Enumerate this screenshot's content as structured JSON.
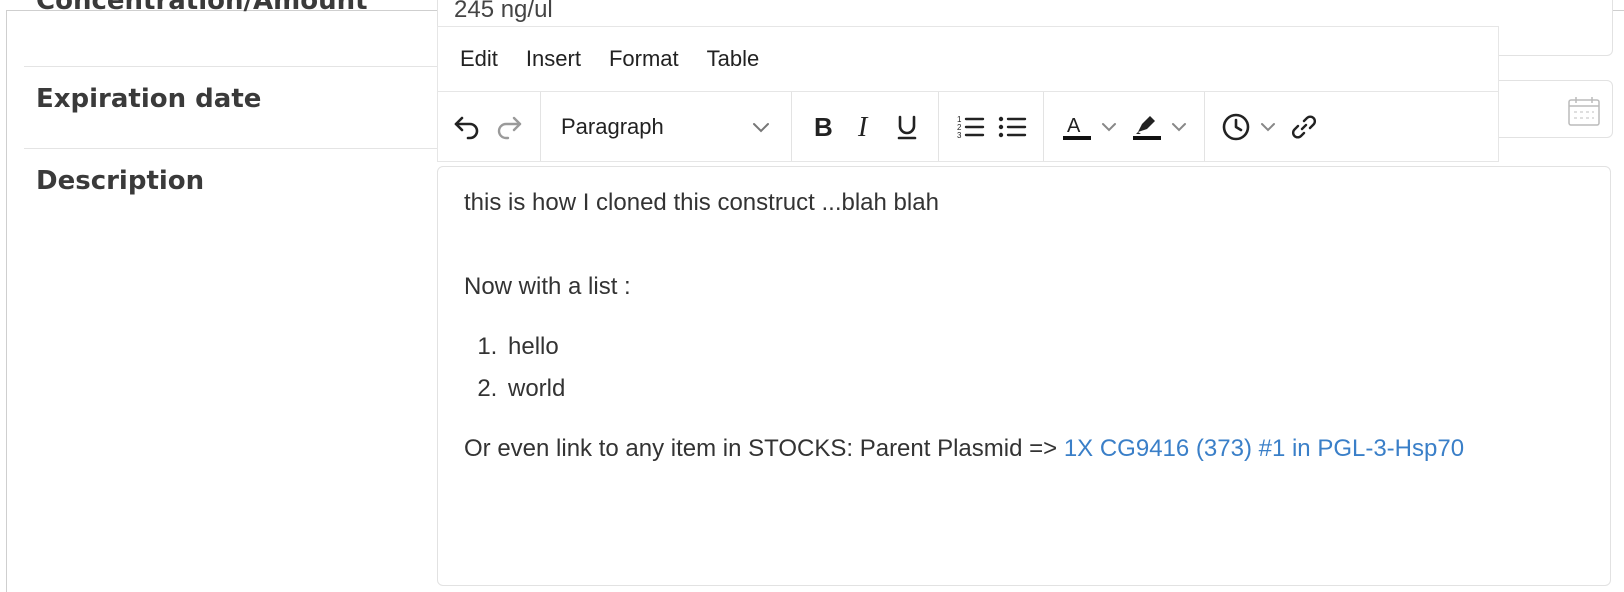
{
  "form": {
    "concentration_label": "Concentration/Amount",
    "concentration_value": "245 ng/ul",
    "expiration_label": "Expiration date",
    "description_label": "Description"
  },
  "editor": {
    "menu": [
      "Edit",
      "Insert",
      "Format",
      "Table"
    ],
    "block_format": "Paragraph",
    "content": {
      "p1": "this is how I cloned this construct ...blah blah",
      "p2": "Now with a list :",
      "list": [
        "hello",
        "world"
      ],
      "p3_prefix": "Or even link to any item in STOCKS: Parent Plasmid =>",
      "p3_link": "1X CG9416 (373) #1 in PGL-3-Hsp70"
    }
  },
  "colors": {
    "link": "#3a7fc8",
    "label": "#3a3a3a",
    "text": "#333333",
    "border": "#e2e2e2"
  },
  "icons": {
    "toolbar": [
      "undo-icon",
      "redo-icon",
      "chevron-down-icon",
      "bold-icon",
      "italic-icon",
      "underline-icon",
      "numbered-list-icon",
      "bullet-list-icon",
      "text-color-icon",
      "highlight-icon",
      "clock-icon",
      "link-icon"
    ],
    "expiration": "calendar-icon"
  }
}
